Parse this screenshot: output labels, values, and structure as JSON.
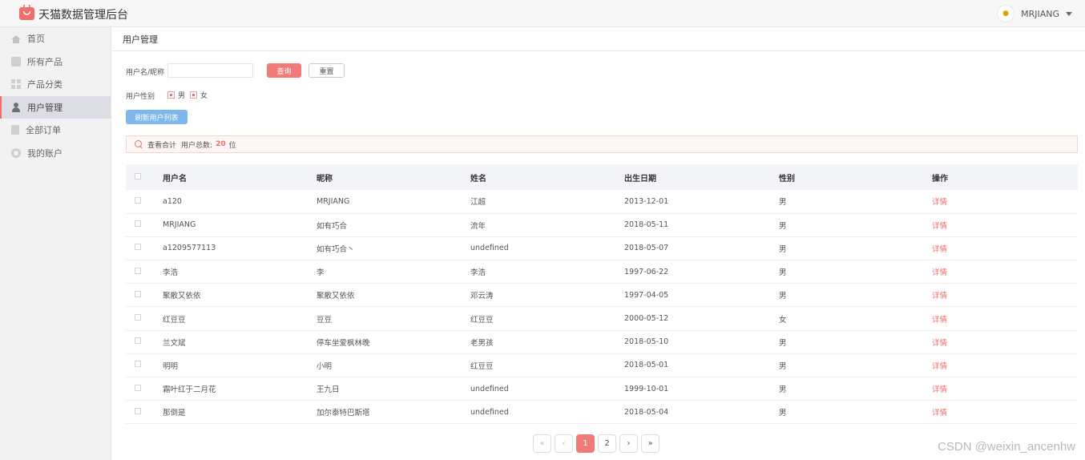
{
  "header": {
    "brand": "天猫数据管理后台",
    "user_name": "MRJIANG"
  },
  "sidebar": {
    "items": [
      {
        "label": "首页",
        "icon": "home-icon"
      },
      {
        "label": "所有产品",
        "icon": "image-icon"
      },
      {
        "label": "产品分类",
        "icon": "grid-icon"
      },
      {
        "label": "用户管理",
        "icon": "user-icon",
        "active": true
      },
      {
        "label": "全部订单",
        "icon": "document-icon"
      },
      {
        "label": "我的账户",
        "icon": "gear-icon"
      }
    ]
  },
  "breadcrumb": "用户管理",
  "filters": {
    "name_label": "用户名/昵称",
    "name_value": "",
    "query_label": "查询",
    "reset_label": "重置",
    "gender_label": "用户性别",
    "gender_options": [
      "男",
      "女"
    ],
    "refresh_label": "刷新用户列表"
  },
  "summary": {
    "prefix": "查看合计",
    "total_label": "用户总数:",
    "total_count": "20",
    "unit": "位"
  },
  "table": {
    "columns": [
      "用户名",
      "昵称",
      "姓名",
      "出生日期",
      "性别",
      "操作"
    ],
    "rows": [
      {
        "username": "a120",
        "nickname": "MRJIANG",
        "realname": "江超",
        "birth": "2013-12-01",
        "gender": "男",
        "action": "详情"
      },
      {
        "username": "MRJIANG",
        "nickname": "如有巧合",
        "realname": "流年",
        "birth": "2018-05-11",
        "gender": "男",
        "action": "详情"
      },
      {
        "username": "a1209577113",
        "nickname": "如有巧合丶",
        "realname": "undefined",
        "birth": "2018-05-07",
        "gender": "男",
        "action": "详情"
      },
      {
        "username": "李浩",
        "nickname": "李",
        "realname": "李浩",
        "birth": "1997-06-22",
        "gender": "男",
        "action": "详情"
      },
      {
        "username": "聚散又依依",
        "nickname": "聚散又依依",
        "realname": "邓云涛",
        "birth": "1997-04-05",
        "gender": "男",
        "action": "详情"
      },
      {
        "username": "红豆豆",
        "nickname": "豆豆",
        "realname": "红豆豆",
        "birth": "2000-05-12",
        "gender": "女",
        "action": "详情"
      },
      {
        "username": "兰文斌",
        "nickname": "停车坐爱枫林晚",
        "realname": "老男孩",
        "birth": "2018-05-10",
        "gender": "男",
        "action": "详情"
      },
      {
        "username": "明明",
        "nickname": "小明",
        "realname": "红豆豆",
        "birth": "2018-05-01",
        "gender": "男",
        "action": "详情"
      },
      {
        "username": "霜叶红于二月花",
        "nickname": "王九日",
        "realname": "undefined",
        "birth": "1999-10-01",
        "gender": "男",
        "action": "详情"
      },
      {
        "username": "那倒是",
        "nickname": "加尔泰特巴斯塔",
        "realname": "undefined",
        "birth": "2018-05-04",
        "gender": "男",
        "action": "详情"
      }
    ]
  },
  "pagination": {
    "first": "«",
    "prev": "‹",
    "pages": [
      "1",
      "2"
    ],
    "current": "1",
    "next": "›",
    "last": "»"
  },
  "watermark": "CSDN @weixin_ancenhw",
  "colors": {
    "accent": "#ef6d6a",
    "refresh_button": "#7db7ee"
  }
}
